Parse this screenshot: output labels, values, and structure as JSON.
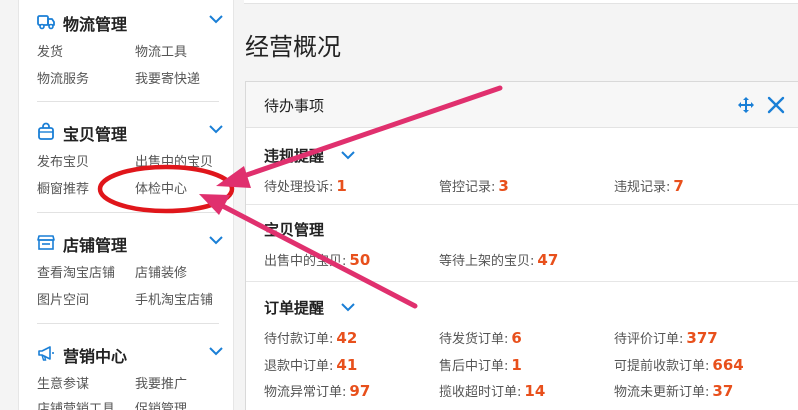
{
  "sidebar": {
    "sections": [
      {
        "title": "物流管理",
        "icon": "truck-icon",
        "links": [
          "发货",
          "物流工具",
          "物流服务",
          "我要寄快递"
        ]
      },
      {
        "title": "宝贝管理",
        "icon": "bag-icon",
        "links": [
          "发布宝贝",
          "出售中的宝贝",
          "橱窗推荐",
          "体检中心"
        ]
      },
      {
        "title": "店铺管理",
        "icon": "store-icon",
        "links": [
          "查看淘宝店铺",
          "店铺装修",
          "图片空间",
          "手机淘宝店铺"
        ]
      },
      {
        "title": "营销中心",
        "icon": "megaphone-icon",
        "links": [
          "生意参谋",
          "我要推广",
          "店铺营销工具",
          "促销管理"
        ]
      }
    ]
  },
  "main": {
    "page_title": "经营概况",
    "card": {
      "title": "待办事项",
      "icons": [
        "move-icon",
        "close-icon"
      ],
      "groups": [
        {
          "title": "违规提醒",
          "items": [
            {
              "label": "待处理投诉:",
              "value": "1"
            },
            {
              "label": "管控记录:",
              "value": "3"
            },
            {
              "label": "违规记录:",
              "value": "7"
            }
          ]
        },
        {
          "title": "宝贝管理",
          "items": [
            {
              "label": "出售中的宝贝:",
              "value": "50"
            },
            {
              "label": "等待上架的宝贝:",
              "value": "47"
            }
          ]
        },
        {
          "title": "订单提醒",
          "items": [
            {
              "label": "待付款订单:",
              "value": "42"
            },
            {
              "label": "待发货订单:",
              "value": "6"
            },
            {
              "label": "待评价订单:",
              "value": "377"
            },
            {
              "label": "退款中订单:",
              "value": "41"
            },
            {
              "label": "售后中订单:",
              "value": "1"
            },
            {
              "label": "可提前收款订单:",
              "value": "664"
            },
            {
              "label": "物流异常订单:",
              "value": "97"
            },
            {
              "label": "揽收超时订单:",
              "value": "14"
            },
            {
              "label": "物流未更新订单:",
              "value": "37"
            }
          ]
        }
      ]
    }
  },
  "colors": {
    "accent_blue": "#1a7fd6",
    "value_orange": "#e8501c",
    "annotation_red": "#e0161b",
    "annotation_pink": "#e0306e"
  }
}
